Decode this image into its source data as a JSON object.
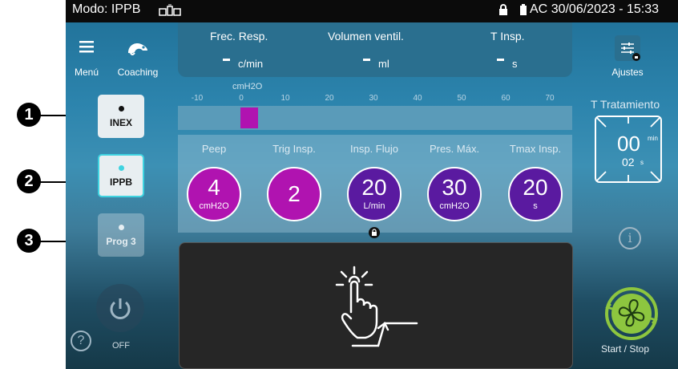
{
  "status": {
    "mode": "Modo: IPPB",
    "datetime": "30/06/2023 - 15:33",
    "power_source": "AC"
  },
  "nav": {
    "menu_label": "Menú",
    "coaching_label": "Coaching",
    "settings_label": "Ajustes"
  },
  "readouts": [
    {
      "label": "Frec. Resp.",
      "value": "-",
      "unit": "c/min"
    },
    {
      "label": "Volumen ventil.",
      "value": "-",
      "unit": "ml"
    },
    {
      "label": "T Insp.",
      "value": "-",
      "unit": "s"
    }
  ],
  "pressure_bar": {
    "unit": "cmH2O",
    "ticks": [
      "-10",
      "0",
      "10",
      "20",
      "30",
      "40",
      "50",
      "60",
      "70"
    ],
    "current": 0
  },
  "params": [
    {
      "label": "Peep",
      "value": "4",
      "unit": "cmH2O",
      "color": "#b013b0"
    },
    {
      "label": "Trig Insp.",
      "value": "2",
      "unit": "",
      "color": "#b013b0"
    },
    {
      "label": "Insp. Flujo",
      "value": "20",
      "unit": "L/min",
      "color": "#5a1aa0"
    },
    {
      "label": "Pres. Máx.",
      "value": "30",
      "unit": "cmH2O",
      "color": "#5a1aa0"
    },
    {
      "label": "Tmax Insp.",
      "value": "20",
      "unit": "s",
      "color": "#5a1aa0"
    }
  ],
  "modes": [
    {
      "label": "INEX",
      "callout": "1"
    },
    {
      "label": "IPPB",
      "callout": "2"
    },
    {
      "label": "Prog 3",
      "callout": "3"
    }
  ],
  "treatment": {
    "title": "T Tratamiento",
    "minutes": "00",
    "min_unit": "min",
    "seconds": "02",
    "sec_unit": "s"
  },
  "power": {
    "label": "OFF"
  },
  "start_stop": {
    "label": "Start / Stop"
  },
  "colors": {
    "accent_green": "#8dc63f",
    "magenta": "#b013b0",
    "purple": "#5a1aa0",
    "selected_border": "#3fd3e0"
  }
}
